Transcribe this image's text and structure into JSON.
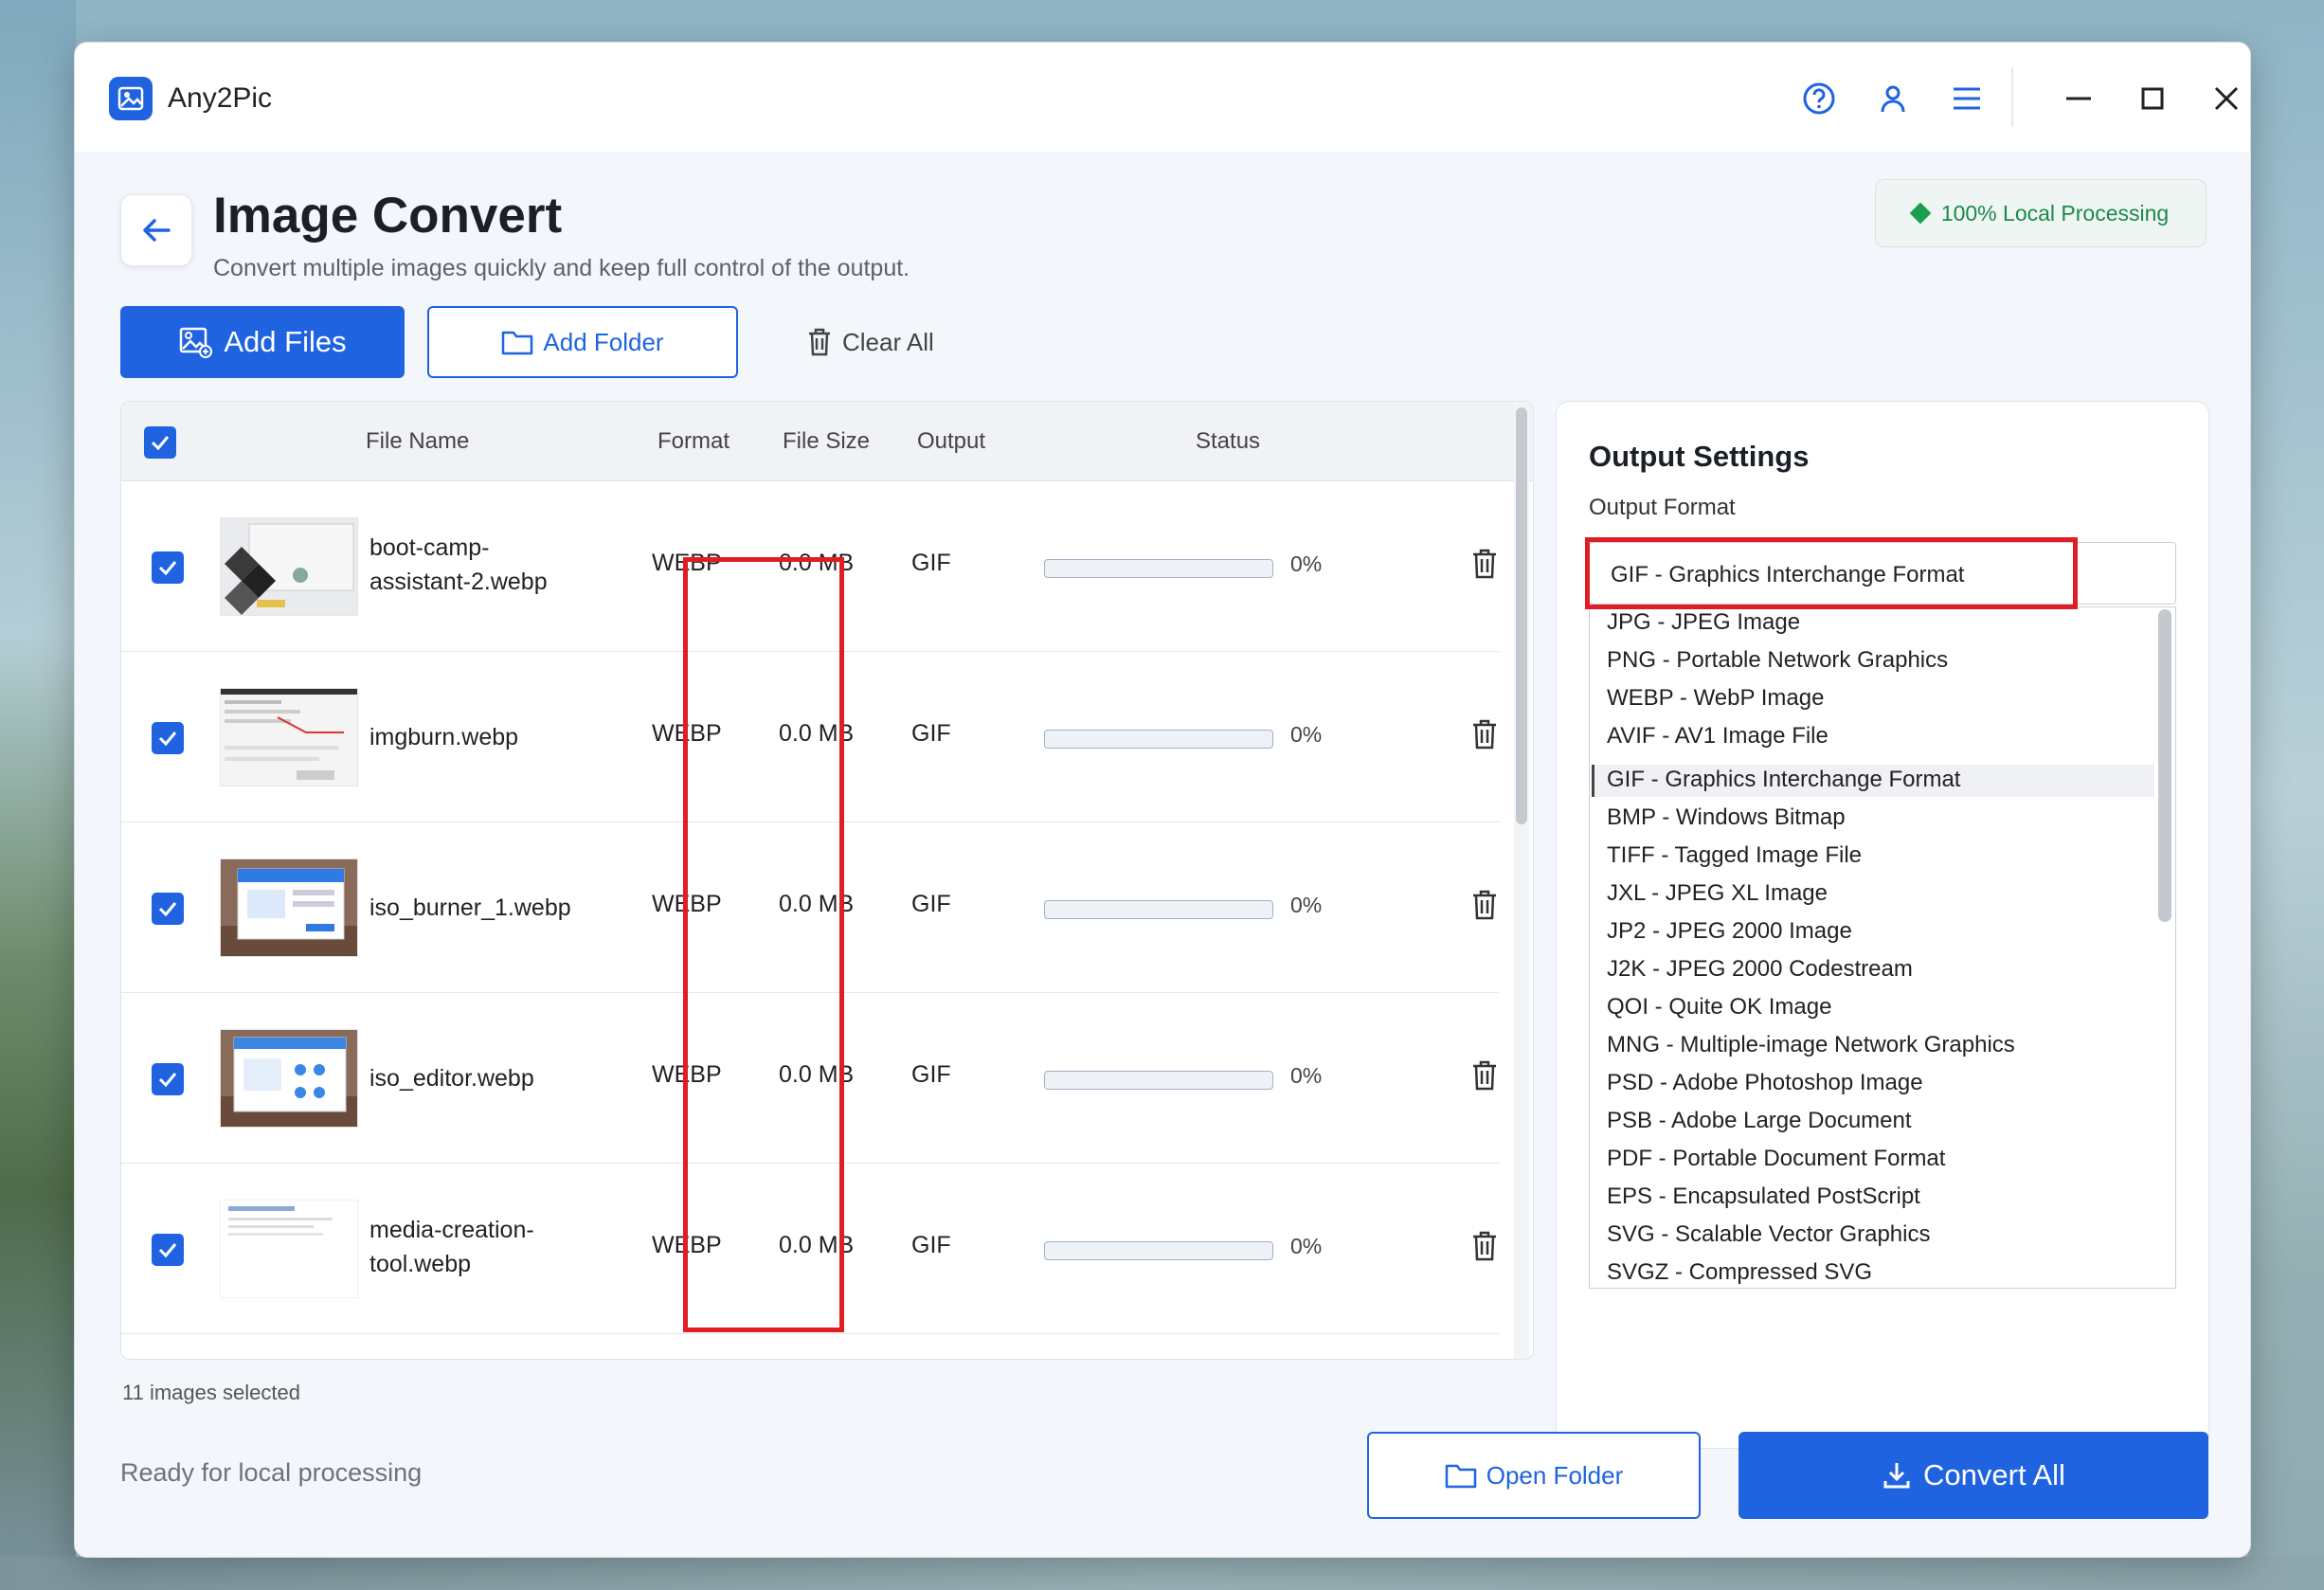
{
  "app": {
    "name": "Any2Pic"
  },
  "header": {
    "title": "Image Convert",
    "subtitle": "Convert multiple images quickly and keep full control of the output.",
    "badge": "100% Local Processing"
  },
  "toolbar": {
    "add_files": "Add Files",
    "add_folder": "Add Folder",
    "clear_all": "Clear All"
  },
  "table": {
    "columns": {
      "file_name": "File Name",
      "format": "Format",
      "file_size": "File Size",
      "output": "Output",
      "status": "Status"
    },
    "rows": [
      {
        "name": "boot-camp-\nassistant-2.webp",
        "format": "WEBP",
        "size": "0.0 MB",
        "output": "GIF",
        "progress": "0%"
      },
      {
        "name": "imgburn.webp",
        "format": "WEBP",
        "size": "0.0 MB",
        "output": "GIF",
        "progress": "0%"
      },
      {
        "name": "iso_burner_1.webp",
        "format": "WEBP",
        "size": "0.0 MB",
        "output": "GIF",
        "progress": "0%"
      },
      {
        "name": "iso_editor.webp",
        "format": "WEBP",
        "size": "0.0 MB",
        "output": "GIF",
        "progress": "0%"
      },
      {
        "name": "media-creation-\ntool.webp",
        "format": "WEBP",
        "size": "0.0 MB",
        "output": "GIF",
        "progress": "0%"
      }
    ]
  },
  "footer": {
    "selected_count": "11 images selected",
    "status": "Ready for local processing",
    "open_folder": "Open Folder",
    "convert_all": "Convert All"
  },
  "settings": {
    "title": "Output Settings",
    "format_label": "Output Format",
    "selected_format": "GIF - Graphics Interchange Format",
    "options": [
      "JPG - JPEG Image",
      "PNG - Portable Network Graphics",
      "WEBP - WebP Image",
      "AVIF - AV1 Image File",
      "GIF - Graphics Interchange Format",
      "BMP - Windows Bitmap",
      "TIFF - Tagged Image File",
      "JXL - JPEG XL Image",
      "JP2 - JPEG 2000 Image",
      "J2K - JPEG 2000 Codestream",
      "QOI - Quite OK Image",
      "MNG - Multiple-image Network Graphics",
      "PSD - Adobe Photoshop Image",
      "PSB - Adobe Large Document",
      "PDF - Portable Document Format",
      "EPS - Encapsulated PostScript",
      "SVG - Scalable Vector Graphics",
      "SVGZ - Compressed SVG"
    ]
  },
  "colors": {
    "accent": "#1f63e0",
    "highlight": "#e11d24",
    "badge_text": "#1a8a4a"
  }
}
